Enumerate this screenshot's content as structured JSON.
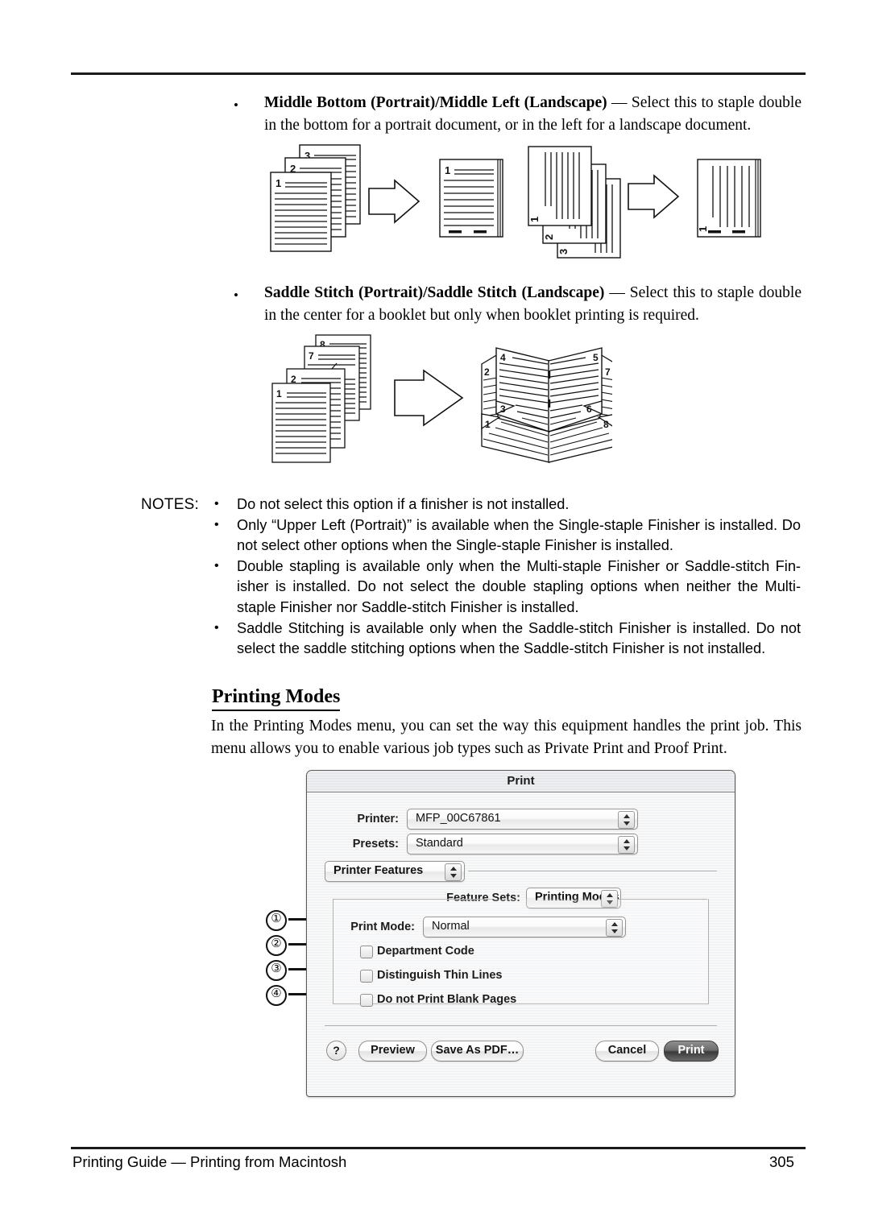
{
  "page": {
    "footer_left": "Printing Guide — Printing from Macintosh",
    "footer_page": "305"
  },
  "bullets": [
    {
      "title": "Middle Bottom (Portrait)/Middle Left (Landscape)",
      "dash": " — ",
      "body": "Select this to staple double in the bottom for a portrait document, or in the left for a landscape document.",
      "marker": "•"
    },
    {
      "title": "Saddle Stitch (Portrait)/Saddle Stitch (Landscape)",
      "dash": " — ",
      "body": "Select this to staple double in the center for a booklet but only when booklet printing is required.",
      "marker": "•"
    }
  ],
  "notes": {
    "label": "NOTES:",
    "marker": "•",
    "items": [
      "Do not select this option if a finisher is not installed.",
      "Only “Upper Left (Portrait)” is available when the Single-staple Finisher is installed. Do not select other options when the Single-staple Finisher is installed.",
      "Double stapling is available only when the Multi-staple Finisher or Saddle-stitch Fin-isher is installed.  Do not select the double stapling options when neither the Multi-staple Finisher nor Saddle-stitch Finisher is installed.",
      "Saddle Stitching is available only when the Saddle-stitch Finisher is installed.  Do not select the saddle stitching options when the Saddle-stitch Finisher is not installed."
    ]
  },
  "section": {
    "heading": "Printing Modes",
    "paragraph": "In the Printing Modes menu, you can set the way this equipment handles the print job.  This menu allows you to enable various job types such as Private Print and Proof Print."
  },
  "figures": {
    "staple_portrait": {
      "stack_labels": [
        "3",
        "2",
        "1"
      ],
      "result_label": "1",
      "arrow": "arrow-right-icon"
    },
    "staple_landscape": {
      "stack_labels": [
        "1",
        "2",
        "3"
      ],
      "result_label": "1",
      "arrow": "arrow-right-icon"
    },
    "saddle_stitch": {
      "stack_labels": [
        "8",
        "7",
        "2",
        "1"
      ],
      "booklet_labels": [
        "4",
        "5",
        "2",
        "7",
        "3",
        "6",
        "1",
        "8"
      ],
      "arrow": "arrow-right-icon"
    }
  },
  "dialog": {
    "title": "Print",
    "printer": {
      "label": "Printer:",
      "value": "MFP_00C67861"
    },
    "presets": {
      "label": "Presets:",
      "value": "Standard"
    },
    "pane": {
      "value": "Printer Features"
    },
    "feature_sets": {
      "label": "Feature Sets:",
      "value": "Printing Modes"
    },
    "print_mode": {
      "label": "Print Mode:",
      "value": "Normal"
    },
    "checkboxes": [
      {
        "label": "Department Code",
        "checked": false
      },
      {
        "label": "Distinguish Thin Lines",
        "checked": false
      },
      {
        "label": "Do not Print Blank Pages",
        "checked": false
      }
    ],
    "buttons": {
      "help": "?",
      "preview": "Preview",
      "save_as_pdf": "Save As PDF…",
      "cancel": "Cancel",
      "print": "Print"
    }
  },
  "callouts": [
    {
      "number": "①"
    },
    {
      "number": "②"
    },
    {
      "number": "③"
    },
    {
      "number": "④"
    }
  ]
}
